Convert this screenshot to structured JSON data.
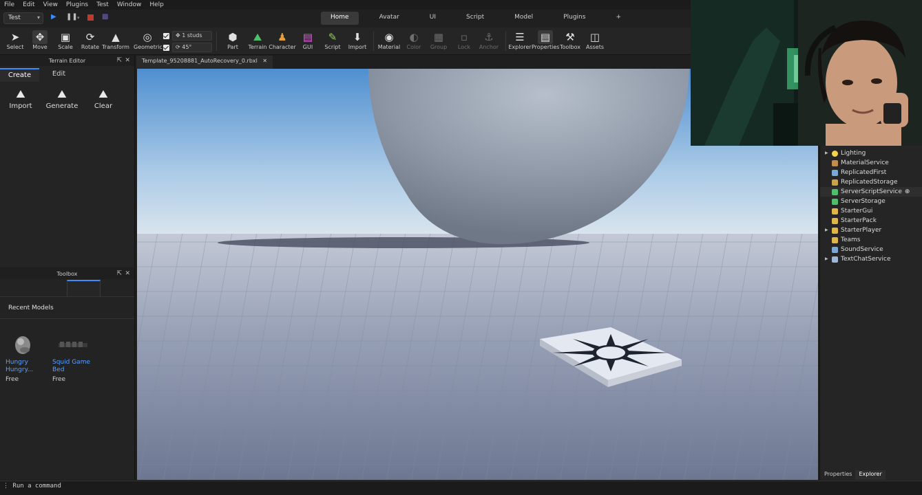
{
  "menu": [
    "File",
    "Edit",
    "View",
    "Plugins",
    "Test",
    "Window",
    "Help"
  ],
  "mode_select": {
    "value": "Test"
  },
  "ribbon_tabs": [
    "Home",
    "Avatar",
    "UI",
    "Script",
    "Model",
    "Plugins",
    "+"
  ],
  "toolbar": {
    "select": "Select",
    "move": "Move",
    "scale": "Scale",
    "rotate": "Rotate",
    "transform": "Transform",
    "geometric": "Geometric",
    "move_snap": "1 studs",
    "rotate_snap": "45°",
    "part": "Part",
    "terrain": "Terrain",
    "character": "Character",
    "gui": "GUI",
    "script": "Script",
    "import": "Import",
    "material": "Material",
    "color": "Color",
    "group": "Group",
    "lock": "Lock",
    "anchor": "Anchor",
    "explorer": "Explorer",
    "properties": "Properties",
    "toolbox": "Toolbox",
    "assets": "Assets"
  },
  "terrain_editor": {
    "title": "Terrain Editor",
    "tabs": [
      "Create",
      "Edit"
    ],
    "tools": [
      "Import",
      "Generate",
      "Clear"
    ]
  },
  "toolbox": {
    "title": "Toolbox",
    "section": "Recent Models",
    "models": [
      {
        "name": "Hungry Hungry...",
        "price": "Free"
      },
      {
        "name": "Squid Game Bed",
        "price": "Free"
      }
    ]
  },
  "document_tab": "Template_95208881_AutoRecovery_0.rbxl",
  "explorer": {
    "items": [
      {
        "label": "Lighting",
        "expandable": true,
        "color": "#f2d44a"
      },
      {
        "label": "MaterialService",
        "expandable": false,
        "color": "#c58b4a"
      },
      {
        "label": "ReplicatedFirst",
        "expandable": false,
        "color": "#7aa9d8"
      },
      {
        "label": "ReplicatedStorage",
        "expandable": false,
        "color": "#c9a24a"
      },
      {
        "label": "ServerScriptService",
        "expandable": false,
        "color": "#4fbf6c"
      },
      {
        "label": "ServerStorage",
        "expandable": false,
        "color": "#4fbf6c"
      },
      {
        "label": "StarterGui",
        "expandable": false,
        "color": "#e0b54a"
      },
      {
        "label": "StarterPack",
        "expandable": false,
        "color": "#e0b54a"
      },
      {
        "label": "StarterPlayer",
        "expandable": true,
        "color": "#e0b54a"
      },
      {
        "label": "Teams",
        "expandable": false,
        "color": "#e0b54a"
      },
      {
        "label": "SoundService",
        "expandable": false,
        "color": "#7aa9d8"
      },
      {
        "label": "TextChatService",
        "expandable": true,
        "color": "#9fb7d6"
      }
    ],
    "bottom_tabs": [
      "Properties",
      "Explorer"
    ]
  },
  "command_bar": {
    "placeholder": "Run a command"
  }
}
